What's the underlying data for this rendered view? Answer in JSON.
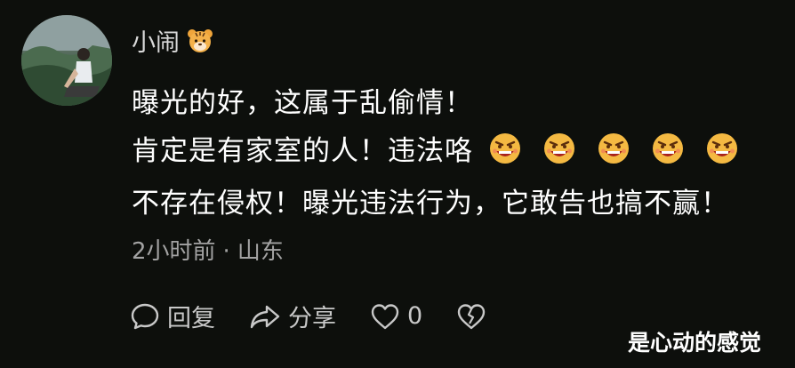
{
  "comment": {
    "username": "小闹",
    "badge_icon": "tiger-face-icon",
    "lines": [
      "曝光的好，这属于乱偷情！",
      "肯定是有家室的人！违法咯",
      "不存在侵权！曝光违法行为，它敢告也搞不赢！"
    ],
    "emoji_icons": [
      "angry-face-icon",
      "angry-face-icon",
      "angry-face-icon",
      "angry-face-icon",
      "angry-face-icon"
    ],
    "time": "2小时前",
    "separator": "·",
    "location": "山东",
    "actions": {
      "reply_label": "回复",
      "share_label": "分享",
      "like_count": "0"
    }
  },
  "watermark": "是心动的感觉",
  "colors": {
    "background": "#0d0f0c",
    "text": "#ffffff",
    "meta": "#a3a3a3",
    "emoji": "#f4b942"
  }
}
